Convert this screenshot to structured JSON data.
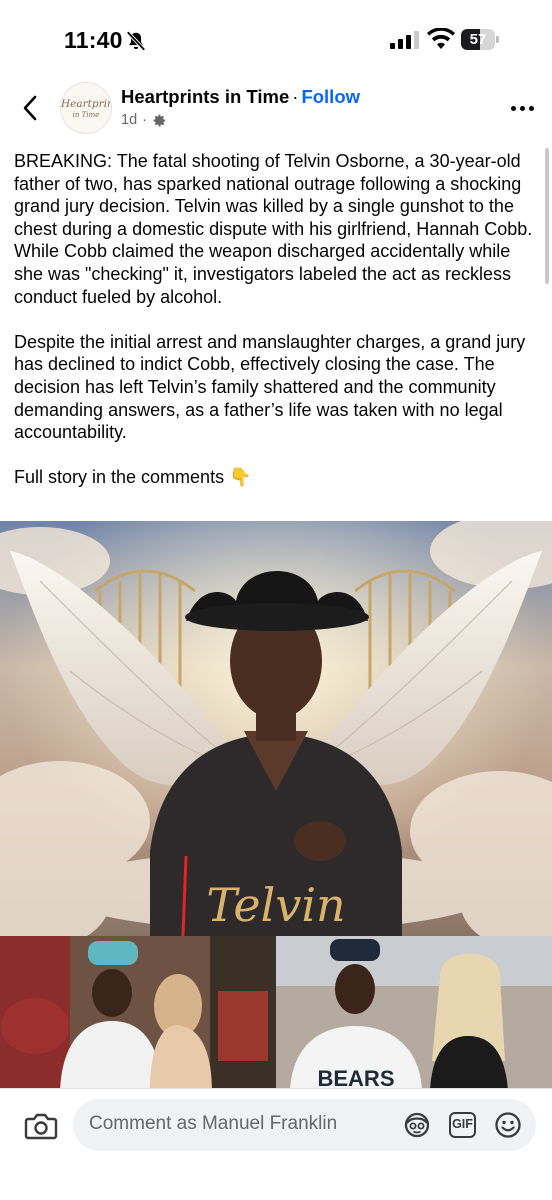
{
  "status_bar": {
    "time": "11:40",
    "battery": "57",
    "battery_level": 0.57
  },
  "post": {
    "page_name": "Heartprints in Time",
    "separator": "·",
    "follow_label": "Follow",
    "age": "1d",
    "meta_separator": "·",
    "avatar_logo_line1": "Heartprints",
    "avatar_logo_line2": "in Time",
    "paragraphs": [
      "BREAKING: The fatal shooting of Telvin Osborne, a 30-year-old father of two, has sparked national outrage following a shocking grand jury decision. Telvin was killed by a single gunshot to the chest during a domestic dispute with his girlfriend, Hannah Cobb. While Cobb claimed the weapon discharged accidentally while she was \"checking\" it, investigators labeled the act as reckless conduct fueled by alcohol.",
      "Despite the initial arrest and manslaughter charges, a grand jury has declined to indict Cobb, effectively closing the case. The decision has left Telvin’s family shattered and the community demanding answers, as a father’s life was taken with no legal accountability.",
      "Full story in the comments 👇"
    ],
    "image_caption_text": "Telvin",
    "image_bottom_jersey_text": "BEARS"
  },
  "comment_bar": {
    "placeholder": "Comment as Manuel Franklin",
    "gif_label": "GIF"
  },
  "icons": {
    "back": "chevron-left-icon",
    "more": "more-horizontal-icon",
    "settings": "gear-icon",
    "camera": "camera-icon",
    "sticker": "avatar-sticker-icon",
    "emoji": "smiley-icon",
    "notifications_off": "bell-slash-icon"
  },
  "colors": {
    "follow": "#0866ff",
    "secondary_text": "#65676b",
    "input_background": "#f0f2f5"
  }
}
